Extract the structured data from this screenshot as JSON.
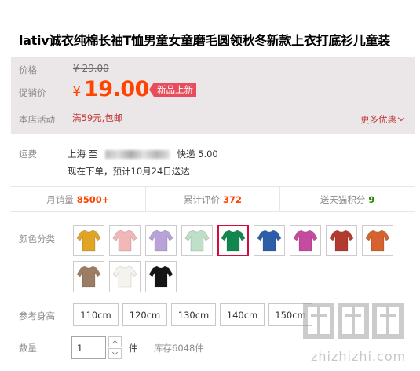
{
  "product": {
    "title": "lativ诚衣纯棉长袖T恤男童女童磨毛圆领秋冬新款上衣打底衫儿童装"
  },
  "pricing": {
    "price_label": "价格",
    "original_price": "¥ 29.00",
    "promo_label": "促销价",
    "currency": "¥",
    "promo_price": "19.00",
    "badge": "新品上新",
    "activity_label": "本店活动",
    "activity_text": "满59元,包邮",
    "more_discount": "更多优惠",
    "colors": {
      "panel_bg": "#ebe7e8",
      "accent": "#ff4400",
      "badge_bg": "#e74e5c"
    }
  },
  "shipping": {
    "label": "运费",
    "origin": "上海",
    "to": "至",
    "method": "快递 5.00",
    "delivery": "现在下单，预计10月24日送达"
  },
  "stats": [
    {
      "label": "月销量",
      "value": "8500+",
      "style": "red"
    },
    {
      "label": "累计评价",
      "value": "372",
      "style": "red"
    },
    {
      "label": "送天猫积分",
      "value": "9",
      "style": "green"
    }
  ],
  "colors_section": {
    "label": "颜色分类",
    "swatches": [
      {
        "icon": "shirt-mustard-icon",
        "color": "#e0a524"
      },
      {
        "icon": "shirt-pink-icon",
        "color": "#f2b8b8"
      },
      {
        "icon": "shirt-lavender-icon",
        "color": "#b8a2d9"
      },
      {
        "icon": "shirt-mint-icon",
        "color": "#bfe0c8"
      },
      {
        "icon": "shirt-green-icon",
        "color": "#11864e",
        "selected": true
      },
      {
        "icon": "shirt-blue-icon",
        "color": "#2d5fa8"
      },
      {
        "icon": "shirt-magenta-icon",
        "color": "#c44b9e"
      },
      {
        "icon": "shirt-brick-icon",
        "color": "#b23a2e"
      },
      {
        "icon": "shirt-orange-icon",
        "color": "#d5622f"
      },
      {
        "icon": "shirt-brown-icon",
        "color": "#9c7d63"
      },
      {
        "icon": "shirt-white-icon",
        "color": "#f5f3ee"
      },
      {
        "icon": "shirt-black-icon",
        "color": "#151515"
      }
    ]
  },
  "sizes": {
    "label": "参考身高",
    "options": [
      "110cm",
      "120cm",
      "130cm",
      "140cm",
      "150cm"
    ]
  },
  "quantity": {
    "label": "数量",
    "value": "1",
    "unit": "件",
    "stock": "库存6048件"
  },
  "watermark": {
    "text": "zhizhizhi.com"
  }
}
